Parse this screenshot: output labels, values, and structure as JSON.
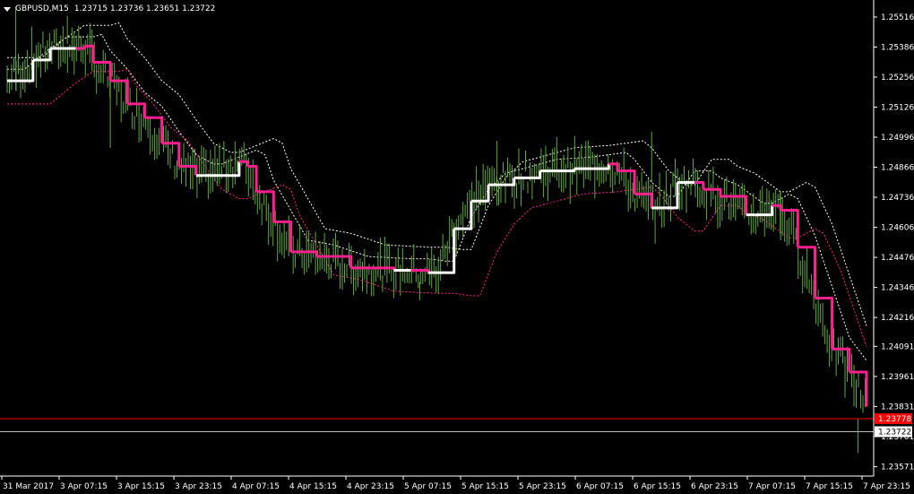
{
  "header": {
    "symbol": "GBPUSD,M15",
    "quote": "1.23715 1.23736 1.23651 1.23722"
  },
  "colors": {
    "background": "#000000",
    "price_bars": "#5fa83a",
    "trail_up": "#ffffff",
    "trail_down": "#ff1f8f",
    "band_upper": "#ffffff",
    "band_lower": "#ff1f8f",
    "axis": "#ffffff",
    "label_red": "#ff0000",
    "label_white": "#ffffff"
  },
  "chart_data": {
    "type": "line",
    "title": "GBPUSD,M15",
    "y_ticks": [
      "1.25516",
      "1.25386",
      "1.25256",
      "1.25126",
      "1.24996",
      "1.24866",
      "1.24736",
      "1.24606",
      "1.24476",
      "1.24346",
      "1.24216",
      "1.24091",
      "1.23961",
      "1.23831",
      "1.23701",
      "1.23571"
    ],
    "x_ticks": [
      "31 Mar 2017",
      "3 Apr 07:15",
      "3 Apr 15:15",
      "3 Apr 23:15",
      "4 Apr 07:15",
      "4 Apr 15:15",
      "4 Apr 23:15",
      "5 Apr 07:15",
      "5 Apr 15:15",
      "5 Apr 23:15",
      "6 Apr 07:15",
      "6 Apr 15:15",
      "6 Apr 23:15",
      "7 Apr 07:15",
      "7 Apr 15:15",
      "7 Apr 23:15"
    ],
    "ylim": [
      1.2353,
      1.2557
    ],
    "price_levels": [
      {
        "value": 1.23778,
        "label": "1.23778",
        "style": "red"
      },
      {
        "value": 1.23722,
        "label": "1.23722",
        "style": "white"
      }
    ],
    "trail_line": [
      {
        "x": 0,
        "y": 1.2524,
        "trend": "up"
      },
      {
        "x": 3,
        "y": 1.2533,
        "trend": "up"
      },
      {
        "x": 5,
        "y": 1.2538,
        "trend": "up"
      },
      {
        "x": 8,
        "y": 1.2538,
        "trend": "up"
      },
      {
        "x": 9,
        "y": 1.2539,
        "trend": "down"
      },
      {
        "x": 10,
        "y": 1.2532,
        "trend": "down"
      },
      {
        "x": 12,
        "y": 1.2524,
        "trend": "down"
      },
      {
        "x": 14,
        "y": 1.2514,
        "trend": "down"
      },
      {
        "x": 16,
        "y": 1.2508,
        "trend": "down"
      },
      {
        "x": 18,
        "y": 1.2497,
        "trend": "down"
      },
      {
        "x": 20,
        "y": 1.2487,
        "trend": "down"
      },
      {
        "x": 22,
        "y": 1.2483,
        "trend": "down"
      },
      {
        "x": 23,
        "y": 1.2483,
        "trend": "up"
      },
      {
        "x": 27,
        "y": 1.2489,
        "trend": "up"
      },
      {
        "x": 28,
        "y": 1.2487,
        "trend": "down"
      },
      {
        "x": 29,
        "y": 1.2476,
        "trend": "down"
      },
      {
        "x": 31,
        "y": 1.2463,
        "trend": "down"
      },
      {
        "x": 33,
        "y": 1.245,
        "trend": "down"
      },
      {
        "x": 36,
        "y": 1.2448,
        "trend": "down"
      },
      {
        "x": 40,
        "y": 1.2443,
        "trend": "down"
      },
      {
        "x": 45,
        "y": 1.2442,
        "trend": "down"
      },
      {
        "x": 47,
        "y": 1.2442,
        "trend": "up"
      },
      {
        "x": 49,
        "y": 1.2441,
        "trend": "down"
      },
      {
        "x": 50,
        "y": 1.2441,
        "trend": "up"
      },
      {
        "x": 52,
        "y": 1.246,
        "trend": "up"
      },
      {
        "x": 54,
        "y": 1.2472,
        "trend": "up"
      },
      {
        "x": 56,
        "y": 1.2479,
        "trend": "up"
      },
      {
        "x": 59,
        "y": 1.2482,
        "trend": "up"
      },
      {
        "x": 62,
        "y": 1.2485,
        "trend": "up"
      },
      {
        "x": 66,
        "y": 1.2486,
        "trend": "up"
      },
      {
        "x": 70,
        "y": 1.2488,
        "trend": "up"
      },
      {
        "x": 71,
        "y": 1.2485,
        "trend": "down"
      },
      {
        "x": 73,
        "y": 1.2475,
        "trend": "down"
      },
      {
        "x": 75,
        "y": 1.2469,
        "trend": "down"
      },
      {
        "x": 76,
        "y": 1.2469,
        "trend": "up"
      },
      {
        "x": 78,
        "y": 1.248,
        "trend": "up"
      },
      {
        "x": 80,
        "y": 1.248,
        "trend": "up"
      },
      {
        "x": 81,
        "y": 1.2477,
        "trend": "down"
      },
      {
        "x": 83,
        "y": 1.2474,
        "trend": "down"
      },
      {
        "x": 86,
        "y": 1.2466,
        "trend": "down"
      },
      {
        "x": 87,
        "y": 1.2466,
        "trend": "up"
      },
      {
        "x": 89,
        "y": 1.247,
        "trend": "up"
      },
      {
        "x": 90,
        "y": 1.2468,
        "trend": "down"
      },
      {
        "x": 92,
        "y": 1.2452,
        "trend": "down"
      },
      {
        "x": 94,
        "y": 1.243,
        "trend": "down"
      },
      {
        "x": 96,
        "y": 1.2408,
        "trend": "down"
      },
      {
        "x": 98,
        "y": 1.2398,
        "trend": "down"
      },
      {
        "x": 100,
        "y": 1.2383,
        "trend": "down"
      }
    ]
  }
}
